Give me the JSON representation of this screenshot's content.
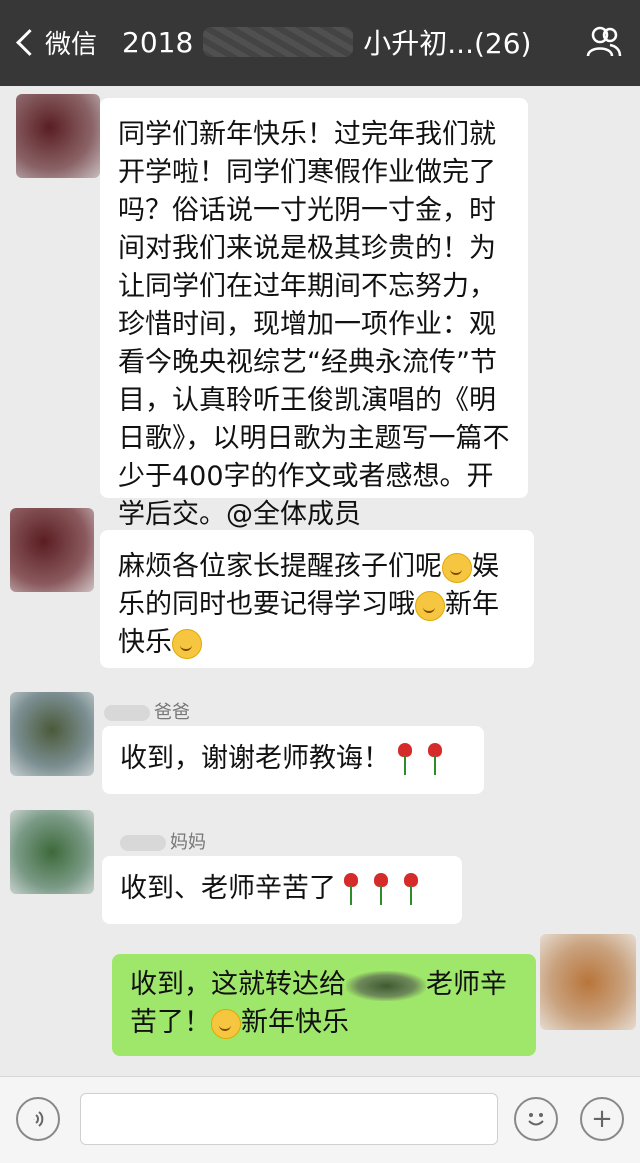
{
  "header": {
    "back_label": "微信",
    "title_prefix": "2018",
    "title_suffix": "小升初...(26)"
  },
  "messages": [
    {
      "sender": "",
      "text": "同学们新年快乐！过完年我们就开学啦！同学们寒假作业做完了吗？俗话说一寸光阴一寸金，时间对我们来说是极其珍贵的！为让同学们在过年期间不忘努力，珍惜时间，现增加一项作业：观看今晚央视综艺“经典永流传”节目，认真聆听王俊凯演唱的《明日歌》，以明日歌为主题写一篇不少于400字的作文或者感想。开学后交。@全体成员"
    },
    {
      "sender": "",
      "parts": [
        "麻烦各位家长提醒孩子们呢",
        "娱乐的同时也要记得学习哦",
        "新年快乐"
      ]
    },
    {
      "sender": "爸爸",
      "text": "收到，谢谢老师教诲！"
    },
    {
      "sender": "妈妈",
      "text": "收到、老师辛苦了"
    },
    {
      "sender": "me",
      "parts": [
        "收到，这就转达给",
        "老师辛苦了！",
        "新年快乐"
      ]
    }
  ],
  "input": {
    "placeholder": ""
  },
  "colors": {
    "topbar": "#373737",
    "chat_bg": "#ebebeb",
    "my_bubble": "#9fe76a",
    "bubble": "#ffffff"
  }
}
